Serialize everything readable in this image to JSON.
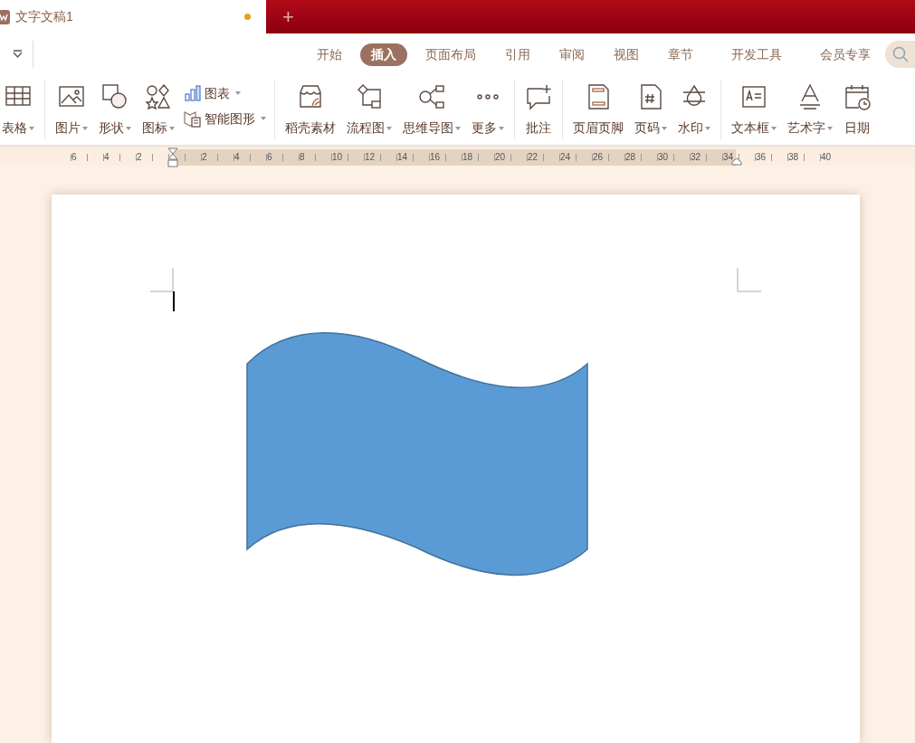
{
  "document_tab": {
    "title": "文字文稿1",
    "unsaved": true
  },
  "new_tab": "+",
  "menu_tabs": [
    {
      "label": "开始",
      "selected": false
    },
    {
      "label": "插入",
      "selected": true
    },
    {
      "label": "页面布局",
      "selected": false
    },
    {
      "label": "引用",
      "selected": false
    },
    {
      "label": "审阅",
      "selected": false
    },
    {
      "label": "视图",
      "selected": false
    },
    {
      "label": "章节",
      "selected": false
    },
    {
      "label": "开发工具",
      "selected": false
    },
    {
      "label": "会员专享",
      "selected": false
    }
  ],
  "ribbon_groups": [
    [
      {
        "kind": "large",
        "label": "表格",
        "dropdown": true
      }
    ],
    [
      {
        "kind": "large",
        "label": "图片",
        "dropdown": true
      },
      {
        "kind": "large",
        "label": "形状",
        "dropdown": true
      },
      {
        "kind": "large",
        "label": "图标",
        "dropdown": true
      },
      {
        "kind": "stack",
        "items": [
          {
            "label": "图表",
            "dropdown": true
          },
          {
            "label": "智能图形",
            "dropdown": true
          }
        ]
      }
    ],
    [
      {
        "kind": "large",
        "label": "稻壳素材",
        "dropdown": false
      },
      {
        "kind": "large",
        "label": "流程图",
        "dropdown": true
      },
      {
        "kind": "large",
        "label": "思维导图",
        "dropdown": true
      },
      {
        "kind": "large",
        "label": "更多",
        "dropdown": true
      }
    ],
    [
      {
        "kind": "large",
        "label": "批注",
        "dropdown": false
      }
    ],
    [
      {
        "kind": "large",
        "label": "页眉页脚",
        "dropdown": false
      },
      {
        "kind": "large",
        "label": "页码",
        "dropdown": true
      },
      {
        "kind": "large",
        "label": "水印",
        "dropdown": true
      }
    ],
    [
      {
        "kind": "large",
        "label": "文本框",
        "dropdown": true
      },
      {
        "kind": "large",
        "label": "艺术字",
        "dropdown": true
      },
      {
        "kind": "large",
        "label": "日期",
        "dropdown": false
      }
    ]
  ],
  "ruler": {
    "left_labels": [
      "6",
      "4",
      "2"
    ],
    "right_labels": [
      "2",
      "4",
      "6",
      "8",
      "10",
      "12",
      "14",
      "16",
      "18",
      "20",
      "22",
      "24",
      "26",
      "28",
      "30",
      "32",
      "34",
      "36",
      "38",
      "40"
    ]
  }
}
